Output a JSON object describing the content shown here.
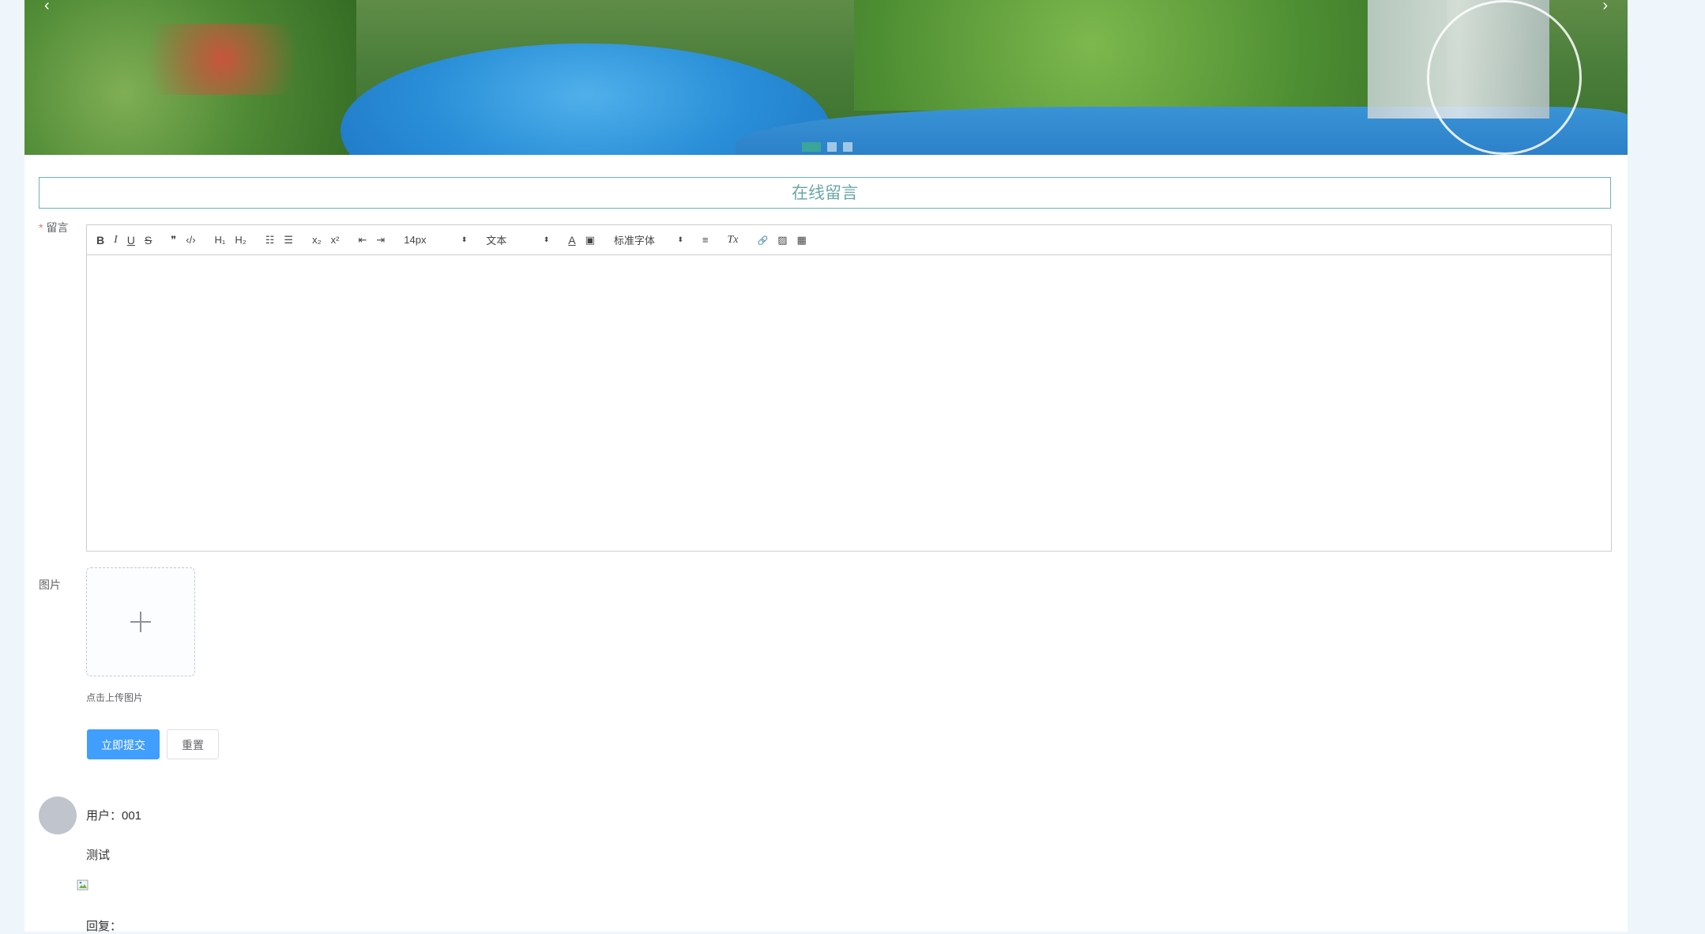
{
  "banner": {
    "prev_arrow": "‹",
    "next_arrow": "›",
    "slide_count": 3,
    "active_slide": 1
  },
  "form": {
    "title": "在线留言",
    "message_label": "留言",
    "required_mark": "*",
    "image_label": "图片",
    "upload_tip": "点击上传图片",
    "submit_label": "立即提交",
    "reset_label": "重置"
  },
  "toolbar": {
    "bold": "B",
    "italic": "I",
    "underline": "U",
    "strike": "S",
    "blockquote": "❞",
    "code": "‹/›",
    "h1": "H₁",
    "h2": "H₂",
    "ordered_list": "☷",
    "bullet_list": "☰",
    "subscript": "x₂",
    "superscript": "x²",
    "outdent": "⇤",
    "indent": "⇥",
    "font_size": "14px",
    "text_type": "文本",
    "text_color": "A",
    "bg_color": "▣",
    "font_family": "标准字体",
    "align": "≡",
    "clean": "Tx",
    "link": "🔗",
    "image": "▨",
    "video": "▦"
  },
  "comment": {
    "user": "用户：001",
    "text": "测试",
    "reply": "回复："
  },
  "colors": {
    "accent": "#409eff",
    "title_border": "#6bb5b3",
    "title_text": "#6aa8a6",
    "page_bg": "#eef6fc"
  }
}
